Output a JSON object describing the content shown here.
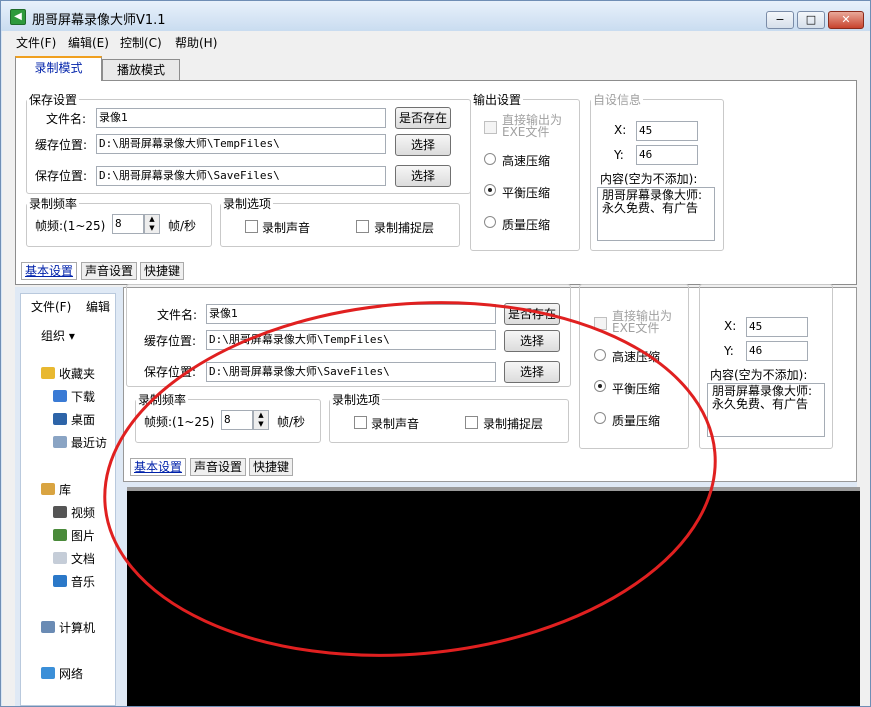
{
  "window": {
    "title": "朋哥屏幕录像大师V1.1",
    "min": "−",
    "max": "□",
    "close": "✕"
  },
  "menu": [
    "文件(F)",
    "编辑(E)",
    "控制(C)",
    "帮助(H)"
  ],
  "tabs": {
    "record": "录制模式",
    "play": "播放模式"
  },
  "save": {
    "legend": "保存设置",
    "filename_label": "文件名:",
    "filename": "录像1",
    "exists_btn": "是否存在",
    "cache_label": "缓存位置:",
    "cache_path": "D:\\朋哥屏幕录像大师\\TempFiles\\",
    "choose1": "选择",
    "save_label": "保存位置:",
    "save_path": "D:\\朋哥屏幕录像大师\\SaveFiles\\",
    "choose2": "选择"
  },
  "output": {
    "legend": "输出设置",
    "direct_exe": "直接输出为\nEXE文件",
    "high": "高速压缩",
    "balance": "平衡压缩",
    "quality": "质量压缩"
  },
  "custom": {
    "legend": "自设信息",
    "x_label": "X:",
    "x": "45",
    "y_label": "Y:",
    "y": "46",
    "content_label": "内容(空为不添加):",
    "content": "朋哥屏幕录像大师:\n永久免费、有广告"
  },
  "freq": {
    "legend": "录制频率",
    "label": "帧频:(1~25)",
    "value": "8",
    "unit": "帧/秒"
  },
  "opts": {
    "legend": "录制选项",
    "sound": "录制声音",
    "layer": "录制捕捉层"
  },
  "subtabs": [
    "基本设置",
    "声音设置",
    "快捷键"
  ],
  "explorer": {
    "menu_file": "文件(F)",
    "menu_edit": "编辑",
    "organize": "组织 ▾",
    "favorites": "收藏夹",
    "download": "下载",
    "desktop": "桌面",
    "recent": "最近访",
    "library": "库",
    "video": "视频",
    "picture": "图片",
    "docs": "文档",
    "music": "音乐",
    "computer": "计算机",
    "network": "网络"
  },
  "echo": {
    "legend_save": "保存设置",
    "legend_out": "输出设置",
    "legend_custom": "自设信息"
  }
}
